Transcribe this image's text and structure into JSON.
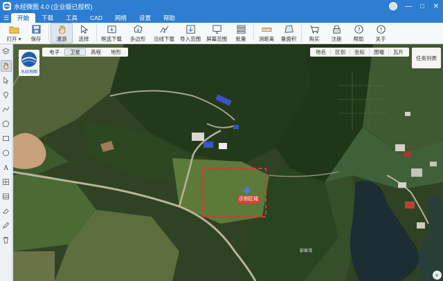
{
  "app": {
    "title": "水经微图 4.0 (企业版已授权)",
    "window_controls": [
      "—",
      "□",
      "✕"
    ]
  },
  "menu": {
    "items": [
      {
        "label": "开始",
        "active": true
      },
      {
        "label": "下载",
        "active": false
      },
      {
        "label": "工具",
        "active": false
      },
      {
        "label": "CAD",
        "active": false
      },
      {
        "label": "网络",
        "active": false
      },
      {
        "label": "设置",
        "active": false
      },
      {
        "label": "帮助",
        "active": false
      }
    ]
  },
  "toolbar": {
    "items": [
      {
        "label": "打开 ▾",
        "icon": "folder-icon"
      },
      {
        "label": "保存",
        "icon": "save-icon"
      },
      {
        "label": "漫游",
        "icon": "hand-icon",
        "active": true
      },
      {
        "label": "选择",
        "icon": "pointer-icon"
      },
      {
        "label": "框选下载",
        "icon": "frame-download-icon"
      },
      {
        "label": "多边形",
        "icon": "polygon-icon"
      },
      {
        "label": "沿线下载",
        "icon": "line-download-icon"
      },
      {
        "label": "导入范围",
        "icon": "import-icon"
      },
      {
        "label": "屏幕范围",
        "icon": "screen-icon"
      },
      {
        "label": "批量",
        "icon": "batch-icon"
      },
      {
        "label": "测距离",
        "icon": "ruler-icon"
      },
      {
        "label": "量面积",
        "icon": "area-icon"
      },
      {
        "label": "购买",
        "icon": "cart-icon"
      },
      {
        "label": "注册",
        "icon": "lock-icon"
      },
      {
        "label": "帮助",
        "icon": "help-icon"
      },
      {
        "label": "关于",
        "icon": "info-icon"
      }
    ]
  },
  "map": {
    "logo_text": "水经地图",
    "map_types": [
      {
        "label": "电子",
        "active": false
      },
      {
        "label": "卫星",
        "active": true
      },
      {
        "label": "高程",
        "active": false
      },
      {
        "label": "地形",
        "active": false
      }
    ],
    "map_tools": [
      "地名",
      "区划",
      "坐标",
      "图幅",
      "瓦片"
    ],
    "task_list_label": "任务列表",
    "region_label": "示例区域",
    "place_label": "彭家湾",
    "colors": {
      "selection_border": "#e0322d",
      "title_bar": "#2d7dd2"
    }
  }
}
